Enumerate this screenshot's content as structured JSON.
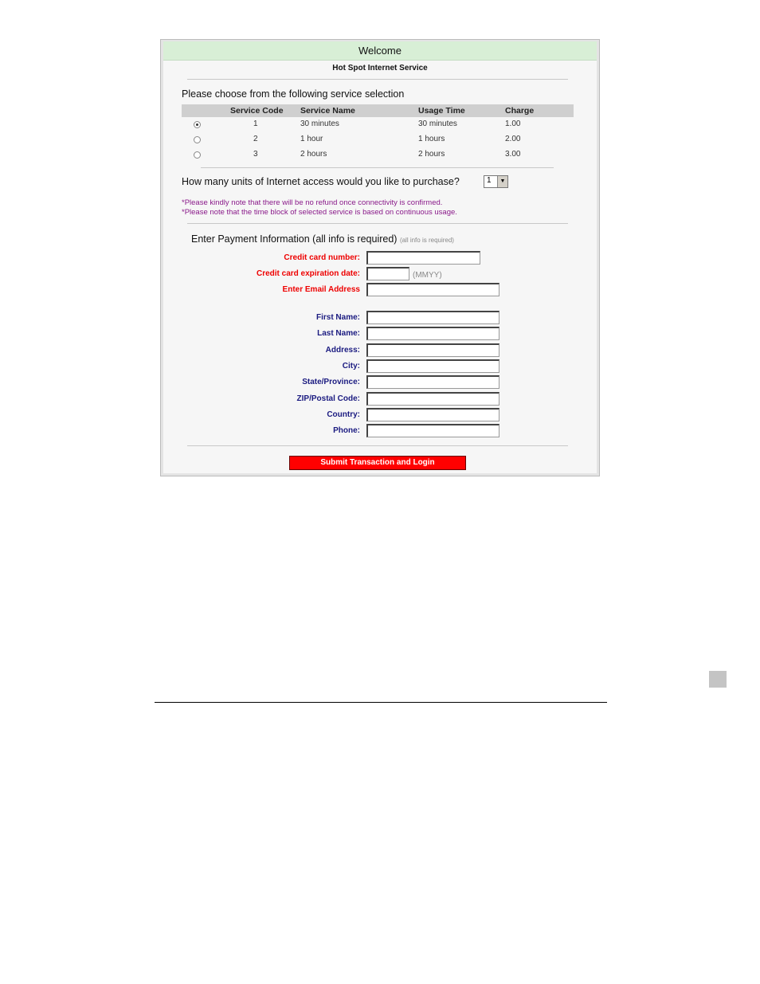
{
  "header": {
    "title": "Welcome",
    "subtitle": "Hot Spot Internet Service"
  },
  "services": {
    "prompt": "Please choose from the following service selection",
    "columns": [
      "Service Code",
      "Service Name",
      "Usage Time",
      "Charge"
    ],
    "rows": [
      {
        "code": "1",
        "name": "30 minutes",
        "usage": "30 minutes",
        "charge": "1.00",
        "selected": true
      },
      {
        "code": "2",
        "name": "1 hour",
        "usage": "1 hours",
        "charge": "2.00",
        "selected": false
      },
      {
        "code": "3",
        "name": "2 hours",
        "usage": "2 hours",
        "charge": "3.00",
        "selected": false
      }
    ]
  },
  "units": {
    "question": "How many units of Internet access would you like to purchase?",
    "value": "1"
  },
  "notes": [
    "*Please kindly note that there will be no refund once connectivity is confirmed.",
    "*Please note that the time block of selected service is based on continuous usage."
  ],
  "payment": {
    "title": "Enter Payment Information (all info is required)",
    "title_small": "(all info is required)",
    "cc_number": "Credit card number:",
    "cc_exp": "Credit card expiration date:",
    "cc_exp_hint": "(MMYY)",
    "email": "Enter Email Address",
    "first_name": "First Name:",
    "last_name": "Last Name:",
    "address": "Address:",
    "city": "City:",
    "state": "State/Province:",
    "zip": "ZIP/Postal Code:",
    "country": "Country:",
    "phone": "Phone:"
  },
  "submit_label": "Submit Transaction and Login",
  "colors": {
    "header_bg": "#d8efd6",
    "submit_bg": "#ff0000",
    "required_label": "#ee0000",
    "label": "#1a1a80",
    "note": "#8a1a8a"
  }
}
